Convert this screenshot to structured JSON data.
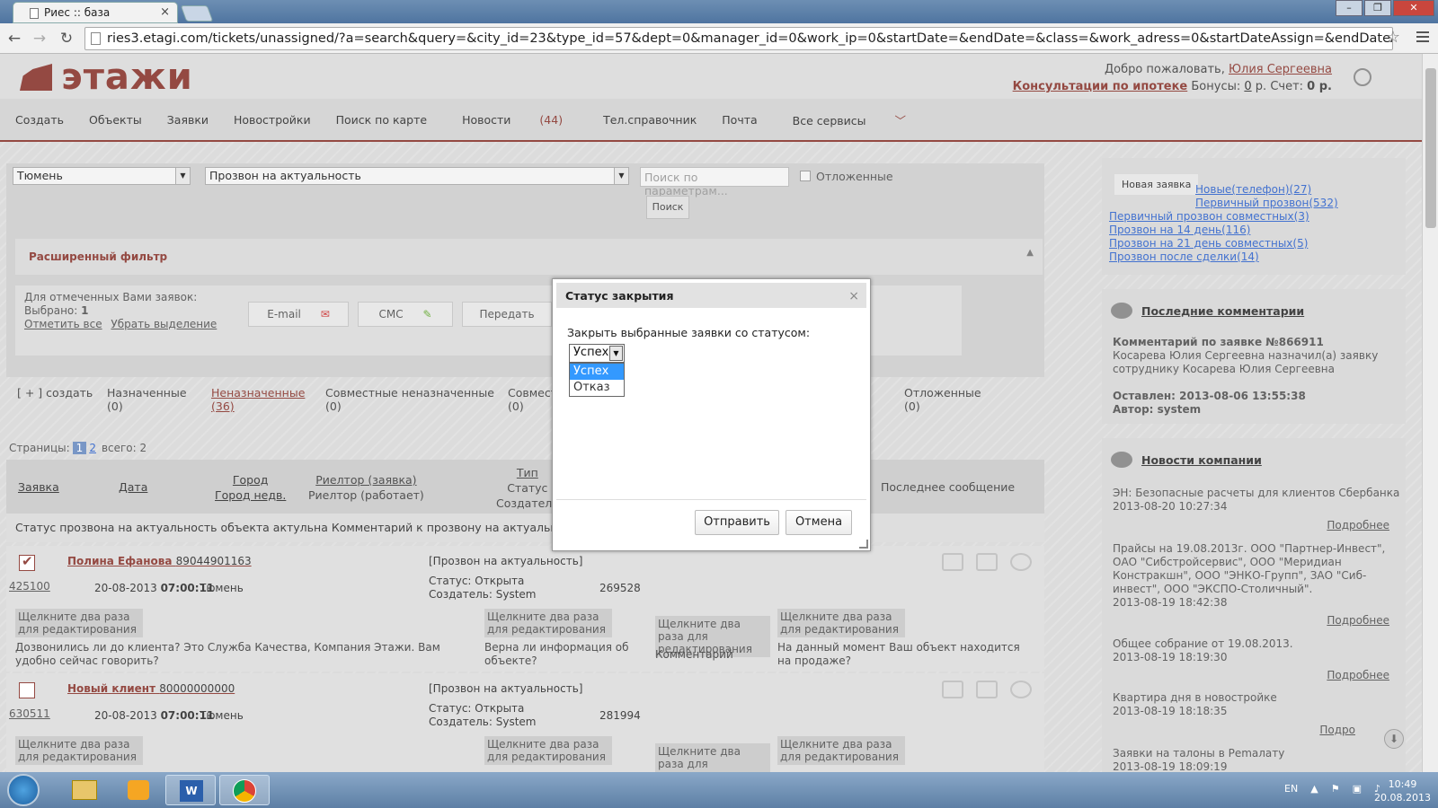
{
  "browser": {
    "tab_title": "Риес :: база",
    "url": "ries3.etagi.com/tickets/unassigned/?a=search&query=&city_id=23&type_id=57&dept=0&manager_id=0&work_ip=0&startDate=&endDate=&class=&work_adress=0&startDateAssign=&endDateAssign=&need_city"
  },
  "header": {
    "logo_text": "этажи",
    "welcome": "Добро пожаловать,",
    "user_name": "Юлия Сергеевна",
    "mortgage_link": "Консультации по ипотеке",
    "bonus_label": "Бонусы:",
    "bonus_value": "0",
    "bonus_rest": "р. Счет:",
    "account_value": "0 р."
  },
  "nav": {
    "items": [
      "Создать",
      "Объекты",
      "Заявки",
      "Новостройки",
      "Поиск по карте"
    ],
    "news": "Новости",
    "news_count": "(44)",
    "phonebook": "Тел.справочник",
    "mail": "Почта",
    "all_services": "Все сервисы"
  },
  "filters": {
    "city": "Тюмень",
    "type": "Прозвон на актуальность",
    "search_placeholder": "Поиск по параметрам...",
    "deferred_label": "Отложенные",
    "search_button": "Поиск",
    "extended": "Расширенный фильтр"
  },
  "actions": {
    "for_selected": "Для отмеченных Вами заявок:",
    "selected_label": "Выбрано:",
    "selected_count": "1",
    "select_all": "Отметить все",
    "deselect": "Убрать выделение",
    "email": "E-mail",
    "sms": "СМС",
    "transfer": "Передать"
  },
  "tabs": {
    "create": "[ + ] создать",
    "assigned": "Назначенные",
    "assigned_count": "(0)",
    "unassigned": "Неназначенные",
    "unassigned_count": "(36)",
    "joint_unassigned": "Совместные неназначенные",
    "joint_unassigned_count": "(0)",
    "joint": "Совмест",
    "joint_count": "(0)",
    "deferred_trail": "е",
    "deferred": "Отложенные",
    "deferred_count": "(0)"
  },
  "pager": {
    "label": "Страницы:",
    "p1": "1",
    "p2": "2",
    "total": "всего: 2"
  },
  "table": {
    "h_ticket": "Заявка",
    "h_date": "Дата",
    "h_city1": "Город",
    "h_city2": "Город недв.",
    "h_realtor1": "Риелтор (заявка)",
    "h_realtor2": "Риелтор (работает)",
    "h_type1": "Тип",
    "h_type2": "Статус",
    "h_type3": "Создатель",
    "h_last": "Последнее сообщение",
    "subheader": "Статус прозвона на актуальность объекта   актульна   Комментарий к прозвону на актуальность   Ак"
  },
  "rows": [
    {
      "name": "Полина Ефанова",
      "phone": "89044901163",
      "id": "425100",
      "date": "20-08-2013",
      "time": "07:00:11",
      "city": "Тюмень",
      "type": "[Прозвон на актуальность]",
      "status": "Статус: Открыта",
      "creator": "Создатель: System",
      "num": "269528",
      "chip": "Щелкните два раза для редактирования",
      "q1": "Дозвонились ли до клиента? Это Служба Качества, Компания Этажи. Вам удобно сейчас говорить?",
      "q2": "Верна ли информация об объекте?",
      "q3": "Комментарий",
      "q4": "На данный момент Ваш объект находится на продаже?"
    },
    {
      "name": "Новый клиент",
      "phone": "80000000000",
      "id": "630511",
      "date": "20-08-2013",
      "time": "07:00:11",
      "city": "Тюмень",
      "type": "[Прозвон на актуальность]",
      "status": "Статус: Открыта",
      "creator": "Создатель: System",
      "num": "281994",
      "chip": "Щелкните два раза для редактирования"
    }
  ],
  "sidebar": {
    "new_ticket": "Новая заявка",
    "links": [
      "Новые(телефон)(27)",
      "Первичный прозвон(532)",
      "Первичный прозвон совместных(3)",
      "Прозвон на 14 день(116)",
      "Прозвон на 21 день совместных(5)",
      "Прозвон после сделки(14)"
    ],
    "comments_title": "Последние комментарии",
    "comment_head": "Комментарий по заявке №866911",
    "comment_body": "Косарева Юлия Сергеевна назначил(а) заявку сотруднику Косарева Юлия Сергеевна",
    "comment_left": "Оставлен: 2013-08-06 13:55:38",
    "comment_author": "Автор: system",
    "news_title": "Новости компании",
    "news": [
      {
        "t": "ЭН: Безопасные расчеты для клиентов Сбербанка",
        "d": "2013-08-20 10:27:34"
      },
      {
        "t": "Прайсы на 19.08.2013г. ООО \"Партнер-Инвест\", ОАО \"Сибстройсервис\", ООО \"Меридиан Констракшн\", ООО \"ЭНКО-Групп\", ЗАО \"Сиб-инвест\", ООО \"ЭКСПО-Столичный\".",
        "d": "2013-08-19 18:42:38"
      },
      {
        "t": "Общее собрание от 19.08.2013.",
        "d": "2013-08-19 18:19:30"
      },
      {
        "t": "Квартира дня в новостройке",
        "d": "2013-08-19 18:18:35"
      },
      {
        "t": "Заявки на талоны в Рemалату",
        "d": "2013-08-19 18:09:19"
      }
    ],
    "more": "Подробнее",
    "more_cut": "Подро"
  },
  "dialog": {
    "title": "Статус закрытия",
    "label": "Закрыть выбранные заявки со статусом:",
    "selected": "Успех",
    "options": [
      "Успех",
      "Отказ"
    ],
    "send": "Отправить",
    "cancel": "Отмена"
  },
  "taskbar": {
    "lang": "EN",
    "time": "10:49",
    "date": "20.08.2013"
  }
}
